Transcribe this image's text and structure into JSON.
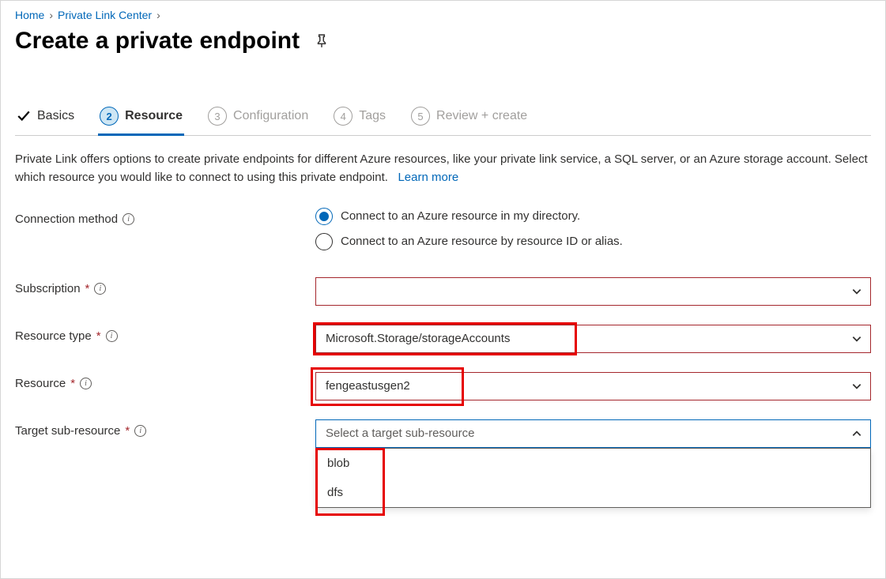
{
  "breadcrumb": {
    "items": [
      "Home",
      "Private Link Center"
    ]
  },
  "page": {
    "title": "Create a private endpoint"
  },
  "tabs": [
    {
      "label": "Basics",
      "state": "completed"
    },
    {
      "num": "2",
      "label": "Resource",
      "state": "active"
    },
    {
      "num": "3",
      "label": "Configuration",
      "state": "pending"
    },
    {
      "num": "4",
      "label": "Tags",
      "state": "pending"
    },
    {
      "num": "5",
      "label": "Review + create",
      "state": "pending"
    }
  ],
  "description": {
    "text": "Private Link offers options to create private endpoints for different Azure resources, like your private link service, a SQL server, or an Azure storage account. Select which resource you would like to connect to using this private endpoint.",
    "learn_more": "Learn more"
  },
  "form": {
    "connection_method": {
      "label": "Connection method",
      "options": [
        "Connect to an Azure resource in my directory.",
        "Connect to an Azure resource by resource ID or alias."
      ],
      "selected": 0
    },
    "subscription": {
      "label": "Subscription",
      "value": ""
    },
    "resource_type": {
      "label": "Resource type",
      "value": "Microsoft.Storage/storageAccounts"
    },
    "resource": {
      "label": "Resource",
      "value": "fengeastusgen2"
    },
    "target_sub_resource": {
      "label": "Target sub-resource",
      "placeholder": "Select a target sub-resource",
      "options": [
        "blob",
        "dfs"
      ]
    }
  }
}
